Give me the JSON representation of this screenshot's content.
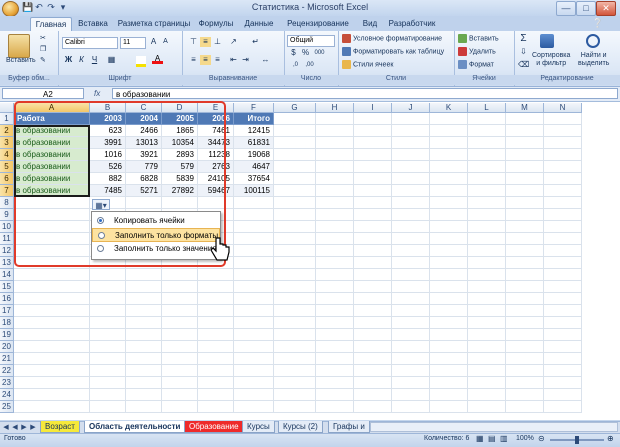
{
  "window": {
    "title": "Статистика - Microsoft Excel"
  },
  "qat": {
    "save_icon": "save-icon",
    "undo_icon": "undo-icon",
    "redo_icon": "redo-icon"
  },
  "tabs": [
    "Главная",
    "Вставка",
    "Разметка страницы",
    "Формулы",
    "Данные",
    "Рецензирование",
    "Вид",
    "Разработчик"
  ],
  "ribbon": {
    "clipboard": {
      "paste": "Вставить",
      "label": "Буфер обм..."
    },
    "font": {
      "name": "Calibri",
      "size": "11",
      "bold": "Ж",
      "italic": "К",
      "underline": "Ч",
      "label": "Шрифт"
    },
    "alignment": {
      "label": "Выравнивание"
    },
    "number": {
      "format": "Общий",
      "label": "Число"
    },
    "styles": {
      "cond": "Условное форматирование",
      "table": "Форматировать как таблицу",
      "cell": "Стили ячеек",
      "label": "Стили"
    },
    "cells": {
      "insert": "Вставить",
      "delete": "Удалить",
      "format": "Формат",
      "label": "Ячейки"
    },
    "editing": {
      "sort": "Сортировка\nи фильтр",
      "find": "Найти и\nвыделить",
      "label": "Редактирование"
    }
  },
  "formula_bar": {
    "name_box": "A2",
    "fx": "fx",
    "formula": "в образовании"
  },
  "columns": [
    "A",
    "B",
    "C",
    "D",
    "E",
    "F",
    "G",
    "H",
    "I",
    "J",
    "K",
    "L",
    "M",
    "N"
  ],
  "rows": [
    "1",
    "2",
    "3",
    "4",
    "5",
    "6",
    "7",
    "8",
    "9",
    "10",
    "11",
    "12",
    "13",
    "14",
    "15",
    "16",
    "17",
    "18",
    "19",
    "20",
    "21",
    "22",
    "23",
    "24",
    "25"
  ],
  "table": {
    "header": [
      "Работа",
      "2003",
      "2004",
      "2005",
      "2006",
      "Итого"
    ],
    "rows": [
      [
        "в образовании",
        "623",
        "2466",
        "1865",
        "7461",
        "12415"
      ],
      [
        "в образовании",
        "3991",
        "13013",
        "10354",
        "34473",
        "61831"
      ],
      [
        "в образовании",
        "1016",
        "3921",
        "2893",
        "11238",
        "19068"
      ],
      [
        "в образовании",
        "526",
        "779",
        "579",
        "2763",
        "4647"
      ],
      [
        "в образовании",
        "882",
        "6828",
        "5839",
        "24105",
        "37654"
      ],
      [
        "в образовании",
        "7485",
        "5271",
        "27892",
        "59467",
        "100115"
      ]
    ]
  },
  "autofill_menu": {
    "items": [
      "Копировать ячейки",
      "Заполнить только форматы",
      "Заполнить только значения"
    ],
    "selected_index": 0,
    "highlight_index": 1
  },
  "sheet_tabs": [
    "Возраст",
    "Область деятельности",
    "Образование",
    "Курсы",
    "Курсы (2)",
    "Графы и"
  ],
  "active_sheet": "Область деятельности",
  "status": {
    "ready": "Готово",
    "count": "Количество: 6",
    "zoom": "100%"
  },
  "colors": {
    "header_fill": "#4f79b5",
    "green_fill": "#d7ebcf",
    "red_frame": "#e03a2a",
    "highlight": "#fde3a1"
  }
}
